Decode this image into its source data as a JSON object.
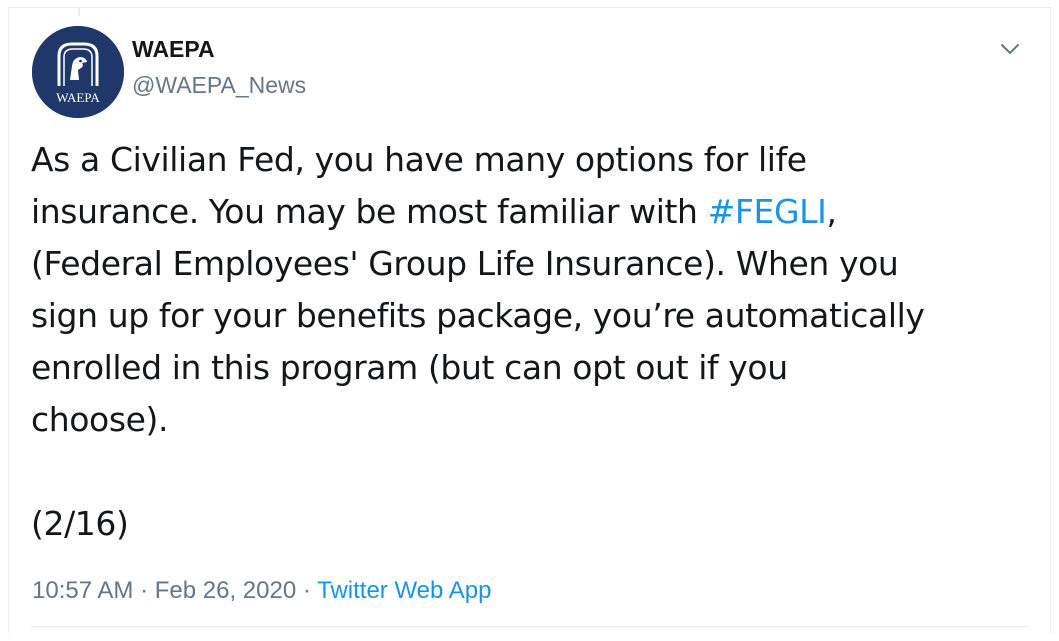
{
  "tweet": {
    "author": {
      "display_name": "WAEPA",
      "handle": "@WAEPA_News",
      "avatar_text": "WAEPA"
    },
    "text_segments": [
      "As a Civilian Fed, you have many options for life\ninsurance. You may be most familiar with ",
      "#FEGLI",
      ",\n(Federal Employees' Group Life Insurance). When you\nsign up for your benefits package, you’re automatically\nenrolled in this program (but can opt out if you\nchoose)."
    ],
    "thread_count": "(2/16)",
    "time": "10:57 AM",
    "separator": "·",
    "date": "Feb 26, 2020",
    "source": "Twitter Web App"
  },
  "colors": {
    "link": "#1b95e0",
    "secondary_text": "#657786",
    "avatar_bg": "#1f3769"
  }
}
